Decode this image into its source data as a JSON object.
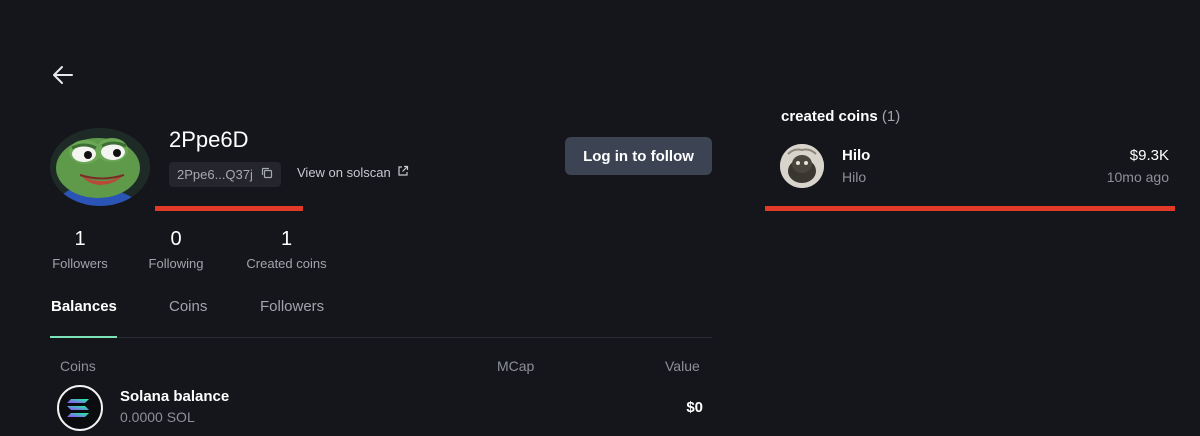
{
  "profile": {
    "username": "2Ppe6D",
    "address_short": "2Ppe6...Q37j",
    "solscan_label": "View on solscan",
    "follow_button": "Log in to follow",
    "avatar_icon": "frog-avatar-icon"
  },
  "stats": [
    {
      "value": "1",
      "label": "Followers"
    },
    {
      "value": "0",
      "label": "Following"
    },
    {
      "value": "1",
      "label": "Created coins"
    }
  ],
  "tabs": [
    {
      "label": "Balances",
      "active": true
    },
    {
      "label": "Coins",
      "active": false
    },
    {
      "label": "Followers",
      "active": false
    }
  ],
  "balances": {
    "columns": [
      "Coins",
      "MCap",
      "Value"
    ],
    "rows": [
      {
        "name": "Solana balance",
        "amount": "0.0000 SOL",
        "value": "$0",
        "icon": "solana-logo-icon"
      }
    ]
  },
  "created_coins": {
    "heading": "created coins",
    "count": "(1)",
    "items": [
      {
        "name": "Hilo",
        "ticker": "Hilo",
        "mcap": "$9.3K",
        "age": "10mo ago"
      }
    ]
  },
  "colors": {
    "background": "#15161b",
    "button": "#3c4454",
    "tab_indicator": "#7ee2b8",
    "annotation_underline": "#e23a28"
  }
}
